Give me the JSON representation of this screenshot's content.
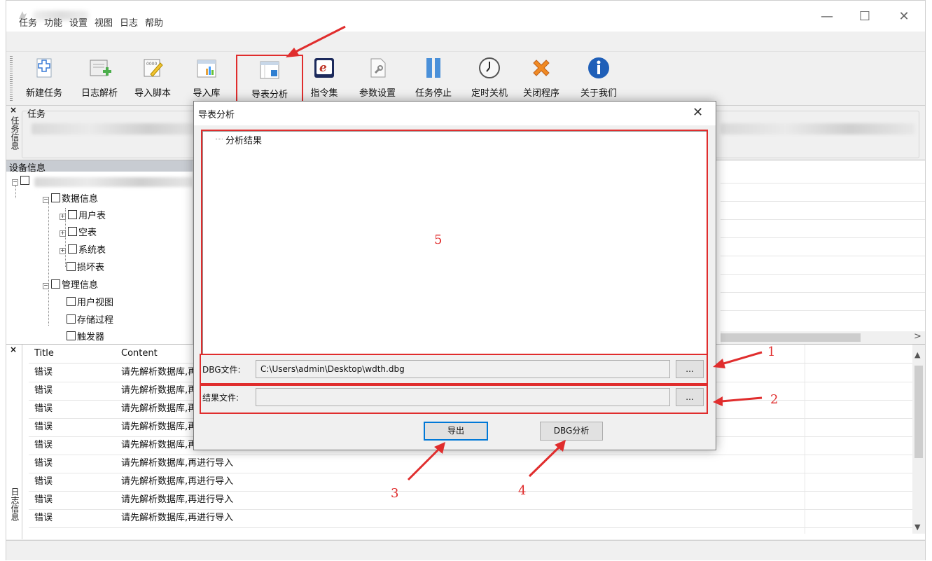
{
  "menu": [
    "任务",
    "功能",
    "设置",
    "视图",
    "日志",
    "帮助"
  ],
  "window_controls": {
    "minimize": "—",
    "maximize": "☐",
    "close": "✕"
  },
  "toolbar": [
    {
      "label": "新建任务",
      "icon": "new-task-icon"
    },
    {
      "label": "日志解析",
      "icon": "log-parse-icon"
    },
    {
      "label": "导入脚本",
      "icon": "import-script-icon"
    },
    {
      "label": "导入库",
      "icon": "import-db-icon"
    },
    {
      "label": "导表分析",
      "icon": "table-analysis-icon"
    },
    {
      "label": "指令集",
      "icon": "instruction-set-icon"
    },
    {
      "label": "参数设置",
      "icon": "param-settings-icon"
    },
    {
      "label": "任务停止",
      "icon": "pause-icon"
    },
    {
      "label": "定时关机",
      "icon": "clock-icon"
    },
    {
      "label": "关闭程序",
      "icon": "close-program-icon"
    },
    {
      "label": "关于我们",
      "icon": "info-icon"
    }
  ],
  "task_panel": {
    "close": "×",
    "title": "任务",
    "side_label": "任务信息"
  },
  "device_panel": {
    "title": "设备信息"
  },
  "tree": [
    {
      "label": "数据信息",
      "expander": "−"
    },
    {
      "label": "用户表",
      "expander": "+"
    },
    {
      "label": "空表",
      "expander": "+"
    },
    {
      "label": "系统表",
      "expander": "+"
    },
    {
      "label": "损坏表",
      "expander": ""
    },
    {
      "label": "管理信息",
      "expander": "−"
    },
    {
      "label": "用户视图",
      "expander": ""
    },
    {
      "label": "存储过程",
      "expander": ""
    },
    {
      "label": "触发器",
      "expander": ""
    }
  ],
  "log_panel": {
    "close": "×",
    "side_label": "日志信息",
    "columns": [
      "Title",
      "Content"
    ],
    "rows": [
      {
        "title": "错误",
        "content": "请先解析数据库,再"
      },
      {
        "title": "错误",
        "content": "请先解析数据库,再"
      },
      {
        "title": "错误",
        "content": "请先解析数据库,再"
      },
      {
        "title": "错误",
        "content": "请先解析数据库,再"
      },
      {
        "title": "错误",
        "content": "请先解析数据库,再进行导入"
      },
      {
        "title": "错误",
        "content": "请先解析数据库,再进行导入"
      },
      {
        "title": "错误",
        "content": "请先解析数据库,再进行导入"
      },
      {
        "title": "错误",
        "content": "请先解析数据库,再进行导入"
      },
      {
        "title": "错误",
        "content": "请先解析数据库,再进行导入"
      }
    ]
  },
  "dialog": {
    "title": "导表分析",
    "close": "✕",
    "result_root": "分析结果",
    "dbg_label": "DBG文件:",
    "dbg_value": "C:\\Users\\admin\\Desktop\\wdth.dbg",
    "result_label": "结果文件:",
    "result_value": "",
    "browse": "...",
    "export_button": "导出",
    "analyze_button": "DBG分析"
  },
  "annotations": {
    "n1": "1",
    "n2": "2",
    "n3": "3",
    "n4": "4",
    "n5": "5"
  },
  "colors": {
    "annotation_red": "#e02d2d",
    "window_bg": "#f0f0f0",
    "focus_blue": "#0078d7"
  }
}
